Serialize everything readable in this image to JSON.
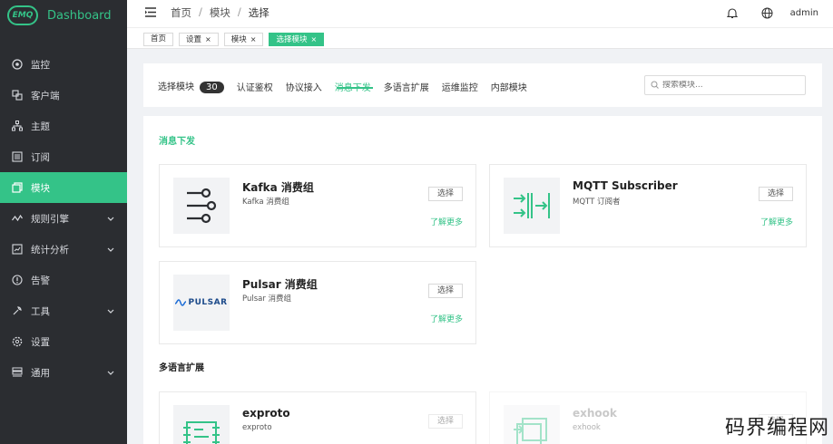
{
  "brand": {
    "logo_text": "EMQ",
    "title": "Dashboard"
  },
  "sidebar": {
    "items": [
      {
        "label": "监控",
        "icon": "monitor-icon",
        "expandable": false
      },
      {
        "label": "客户端",
        "icon": "clients-icon",
        "expandable": false
      },
      {
        "label": "主题",
        "icon": "topics-icon",
        "expandable": false
      },
      {
        "label": "订阅",
        "icon": "subscriptions-icon",
        "expandable": false
      },
      {
        "label": "模块",
        "icon": "modules-icon",
        "expandable": false,
        "active": true
      },
      {
        "label": "规则引擎",
        "icon": "rules-icon",
        "expandable": true
      },
      {
        "label": "统计分析",
        "icon": "analytics-icon",
        "expandable": true
      },
      {
        "label": "告警",
        "icon": "alarm-icon",
        "expandable": false
      },
      {
        "label": "工具",
        "icon": "tools-icon",
        "expandable": true
      },
      {
        "label": "设置",
        "icon": "settings-icon",
        "expandable": false
      },
      {
        "label": "通用",
        "icon": "general-icon",
        "expandable": true
      }
    ]
  },
  "header": {
    "breadcrumb": [
      "首页",
      "模块",
      "选择"
    ],
    "user": "admin"
  },
  "tags": [
    {
      "label": "首页",
      "closable": false,
      "active": false
    },
    {
      "label": "设置",
      "closable": true,
      "active": false
    },
    {
      "label": "模块",
      "closable": true,
      "active": false
    },
    {
      "label": "选择模块",
      "closable": true,
      "active": true
    }
  ],
  "filter": {
    "title": "选择模块",
    "count": "30",
    "tabs": [
      "认证鉴权",
      "协议接入",
      "消息下发",
      "多语言扩展",
      "运维监控",
      "内部模块"
    ],
    "active_tab": "消息下发",
    "search_placeholder": "搜索模块..."
  },
  "sections": [
    {
      "title": "消息下发",
      "cards": [
        {
          "name": "Kafka 消费组",
          "sub": "Kafka 消费组",
          "select": "选择",
          "more": "了解更多",
          "logo": "kafka-logo"
        },
        {
          "name": "MQTT Subscriber",
          "sub": "MQTT 订阅者",
          "select": "选择",
          "more": "了解更多",
          "logo": "mqtt-logo"
        },
        {
          "name": "Pulsar 消费组",
          "sub": "Pulsar 消费组",
          "select": "选择",
          "more": "了解更多",
          "logo": "pulsar-logo",
          "logo_text": "PULSAR"
        }
      ]
    },
    {
      "title": "多语言扩展",
      "cards": [
        {
          "name": "exproto",
          "sub": "exproto",
          "select": "选择",
          "logo": "exproto-logo"
        },
        {
          "name": "exhook",
          "sub": "exhook",
          "select": "选择",
          "logo": "exhook-logo",
          "disabled": true
        }
      ]
    }
  ],
  "watermark": "码界编程网",
  "colors": {
    "accent": "#34c388",
    "sidebar_bg": "#2b2d31"
  }
}
